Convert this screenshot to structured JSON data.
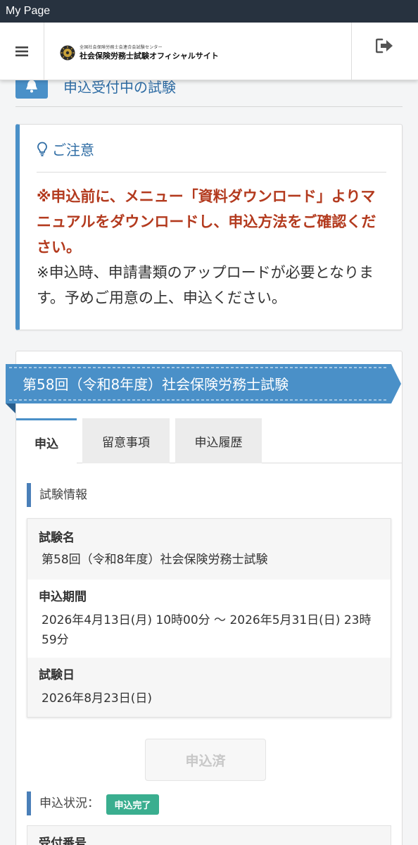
{
  "window": {
    "title": "My Page"
  },
  "header": {
    "logo_sub": "全国社会保険労務士会連合会試験センター",
    "logo_main": "社会保険労務士試験オフィシャルサイト"
  },
  "page_heading": "申込受付中の試験",
  "notice": {
    "title": "ご注意",
    "warning": "※申込前に、メニュー「資料ダウンロード」よりマニュアルをダウンロードし、申込方法をご確認ください。",
    "body": "※申込時、申請書類のアップロードが必要となります。予めご用意の上、申込ください。"
  },
  "exam": {
    "ribbon_title": "第58回（令和8年度）社会保険労務士試験",
    "tabs": [
      {
        "label": "申込",
        "active": true
      },
      {
        "label": "留意事項",
        "active": false
      },
      {
        "label": "申込履歴",
        "active": false
      }
    ],
    "info_section_label": "試験情報",
    "info": {
      "name_label": "試験名",
      "name_value": "第58回（令和8年度）社会保険労務士試験",
      "period_label": "申込期間",
      "period_value": "2026年4月13日(月) 10時00分 〜 2026年5月31日(日) 23時59分",
      "date_label": "試験日",
      "date_value": "2026年8月23日(日)"
    },
    "applied_button": "申込済",
    "status_label": "申込状況：",
    "status_badge": "申込完了",
    "receipt_label": "受付番号"
  },
  "colors": {
    "accent": "#4a90c8",
    "warning": "#b33a1e",
    "status": "#3aae8f",
    "titlebar": "#27323f"
  }
}
